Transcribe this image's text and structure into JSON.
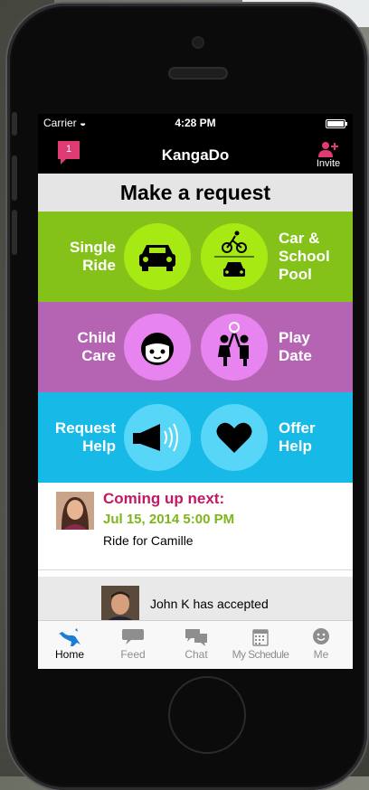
{
  "status": {
    "carrier": "Carrier",
    "time": "4:28 PM"
  },
  "nav": {
    "title": "KangaDo",
    "badge": "1",
    "invite_label": "Invite"
  },
  "request": {
    "header": "Make a request",
    "rows": [
      {
        "left_label": "Single\nRide",
        "right_label": "Car &\nSchool\nPool",
        "left_icon": "car-icon",
        "right_icon": "bike-car-pool-icon"
      },
      {
        "left_label": "Child\nCare",
        "right_label": "Play\nDate",
        "left_icon": "child-face-icon",
        "right_icon": "kids-playing-icon"
      },
      {
        "left_label": "Request\nHelp",
        "right_label": "Offer\nHelp",
        "left_icon": "megaphone-icon",
        "right_icon": "heart-icon"
      }
    ],
    "colors": {
      "green": "#84c21a",
      "purple": "#b564b4",
      "blue": "#17b9e6"
    }
  },
  "upnext": {
    "heading": "Coming up next:",
    "datetime": "Jul 15, 2014 5:00 PM",
    "description": "Ride for Camille"
  },
  "activity": {
    "text": "John K has accepted"
  },
  "tabs": [
    {
      "label": "Home",
      "icon": "kangaroo-icon"
    },
    {
      "label": "Feed",
      "icon": "speech-bubble-icon"
    },
    {
      "label": "Chat",
      "icon": "chat-bubbles-icon"
    },
    {
      "label": "My Schedule",
      "icon": "calendar-icon"
    },
    {
      "label": "Me",
      "icon": "smiley-icon"
    }
  ],
  "active_tab": "Home"
}
